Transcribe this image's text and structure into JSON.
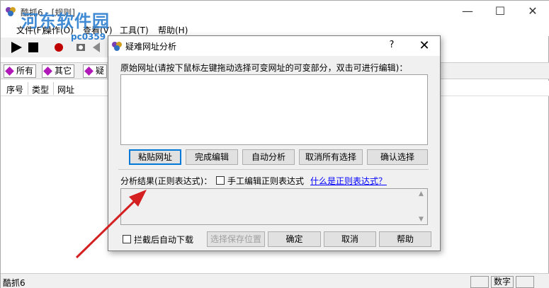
{
  "window": {
    "title": "酷抓6 - [规则]",
    "watermark": "河东软件园",
    "watermark_url": "pc0359"
  },
  "menu": {
    "items": [
      "文件(F)",
      "操作(O)",
      "查看(V)",
      "工具(T)",
      "帮助(H)"
    ]
  },
  "filters": {
    "tabs": [
      "所有",
      "其它",
      "疑"
    ]
  },
  "columns": [
    "序号",
    "类型",
    "网址"
  ],
  "status": {
    "main": "酷抓6",
    "num_lock": "数字"
  },
  "dialog": {
    "title": "疑难网址分析",
    "help_symbol": "?",
    "original_url_label": "原始网址(请按下鼠标左键拖动选择可变网址的可变部分，双击可进行编辑)：",
    "original_url_value": "",
    "buttons": {
      "paste": "粘贴网址",
      "finish_edit": "完成编辑",
      "auto_analyze": "自动分析",
      "cancel_all": "取消所有选择",
      "confirm_select": "确认选择"
    },
    "result_label": "分析结果(正则表达式)：",
    "manual_edit_label": "手工编辑正则表达式",
    "what_is_regex": "什么是正则表达式？",
    "result_value": "",
    "auto_download_label": "拦截后自动下载",
    "bottom_buttons": {
      "choose_save": "选择保存位置",
      "ok": "确定",
      "cancel": "取消",
      "help": "帮助"
    }
  },
  "colors": {
    "filter_icon": "#b018b8",
    "link": "#0000ff",
    "arrow": "#d42020",
    "watermark": "#2d7fd1"
  }
}
